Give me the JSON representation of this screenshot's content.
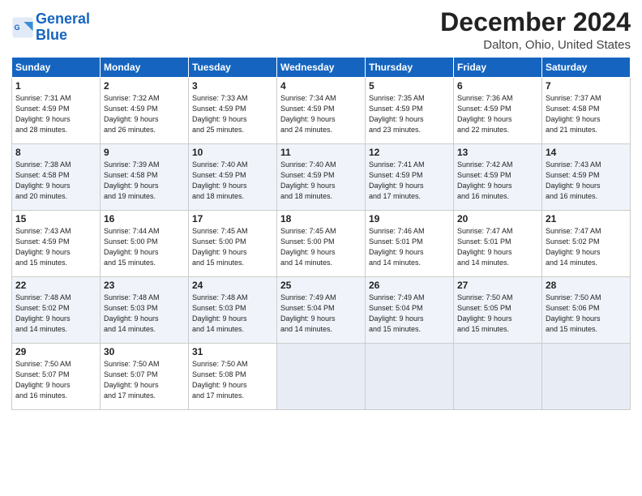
{
  "logo": {
    "line1": "General",
    "line2": "Blue"
  },
  "header": {
    "month": "December 2024",
    "location": "Dalton, Ohio, United States"
  },
  "days_of_week": [
    "Sunday",
    "Monday",
    "Tuesday",
    "Wednesday",
    "Thursday",
    "Friday",
    "Saturday"
  ],
  "weeks": [
    [
      {
        "day": "1",
        "info": "Sunrise: 7:31 AM\nSunset: 4:59 PM\nDaylight: 9 hours\nand 28 minutes."
      },
      {
        "day": "2",
        "info": "Sunrise: 7:32 AM\nSunset: 4:59 PM\nDaylight: 9 hours\nand 26 minutes."
      },
      {
        "day": "3",
        "info": "Sunrise: 7:33 AM\nSunset: 4:59 PM\nDaylight: 9 hours\nand 25 minutes."
      },
      {
        "day": "4",
        "info": "Sunrise: 7:34 AM\nSunset: 4:59 PM\nDaylight: 9 hours\nand 24 minutes."
      },
      {
        "day": "5",
        "info": "Sunrise: 7:35 AM\nSunset: 4:59 PM\nDaylight: 9 hours\nand 23 minutes."
      },
      {
        "day": "6",
        "info": "Sunrise: 7:36 AM\nSunset: 4:59 PM\nDaylight: 9 hours\nand 22 minutes."
      },
      {
        "day": "7",
        "info": "Sunrise: 7:37 AM\nSunset: 4:58 PM\nDaylight: 9 hours\nand 21 minutes."
      }
    ],
    [
      {
        "day": "8",
        "info": "Sunrise: 7:38 AM\nSunset: 4:58 PM\nDaylight: 9 hours\nand 20 minutes."
      },
      {
        "day": "9",
        "info": "Sunrise: 7:39 AM\nSunset: 4:58 PM\nDaylight: 9 hours\nand 19 minutes."
      },
      {
        "day": "10",
        "info": "Sunrise: 7:40 AM\nSunset: 4:59 PM\nDaylight: 9 hours\nand 18 minutes."
      },
      {
        "day": "11",
        "info": "Sunrise: 7:40 AM\nSunset: 4:59 PM\nDaylight: 9 hours\nand 18 minutes."
      },
      {
        "day": "12",
        "info": "Sunrise: 7:41 AM\nSunset: 4:59 PM\nDaylight: 9 hours\nand 17 minutes."
      },
      {
        "day": "13",
        "info": "Sunrise: 7:42 AM\nSunset: 4:59 PM\nDaylight: 9 hours\nand 16 minutes."
      },
      {
        "day": "14",
        "info": "Sunrise: 7:43 AM\nSunset: 4:59 PM\nDaylight: 9 hours\nand 16 minutes."
      }
    ],
    [
      {
        "day": "15",
        "info": "Sunrise: 7:43 AM\nSunset: 4:59 PM\nDaylight: 9 hours\nand 15 minutes."
      },
      {
        "day": "16",
        "info": "Sunrise: 7:44 AM\nSunset: 5:00 PM\nDaylight: 9 hours\nand 15 minutes."
      },
      {
        "day": "17",
        "info": "Sunrise: 7:45 AM\nSunset: 5:00 PM\nDaylight: 9 hours\nand 15 minutes."
      },
      {
        "day": "18",
        "info": "Sunrise: 7:45 AM\nSunset: 5:00 PM\nDaylight: 9 hours\nand 14 minutes."
      },
      {
        "day": "19",
        "info": "Sunrise: 7:46 AM\nSunset: 5:01 PM\nDaylight: 9 hours\nand 14 minutes."
      },
      {
        "day": "20",
        "info": "Sunrise: 7:47 AM\nSunset: 5:01 PM\nDaylight: 9 hours\nand 14 minutes."
      },
      {
        "day": "21",
        "info": "Sunrise: 7:47 AM\nSunset: 5:02 PM\nDaylight: 9 hours\nand 14 minutes."
      }
    ],
    [
      {
        "day": "22",
        "info": "Sunrise: 7:48 AM\nSunset: 5:02 PM\nDaylight: 9 hours\nand 14 minutes."
      },
      {
        "day": "23",
        "info": "Sunrise: 7:48 AM\nSunset: 5:03 PM\nDaylight: 9 hours\nand 14 minutes."
      },
      {
        "day": "24",
        "info": "Sunrise: 7:48 AM\nSunset: 5:03 PM\nDaylight: 9 hours\nand 14 minutes."
      },
      {
        "day": "25",
        "info": "Sunrise: 7:49 AM\nSunset: 5:04 PM\nDaylight: 9 hours\nand 14 minutes."
      },
      {
        "day": "26",
        "info": "Sunrise: 7:49 AM\nSunset: 5:04 PM\nDaylight: 9 hours\nand 15 minutes."
      },
      {
        "day": "27",
        "info": "Sunrise: 7:50 AM\nSunset: 5:05 PM\nDaylight: 9 hours\nand 15 minutes."
      },
      {
        "day": "28",
        "info": "Sunrise: 7:50 AM\nSunset: 5:06 PM\nDaylight: 9 hours\nand 15 minutes."
      }
    ],
    [
      {
        "day": "29",
        "info": "Sunrise: 7:50 AM\nSunset: 5:07 PM\nDaylight: 9 hours\nand 16 minutes."
      },
      {
        "day": "30",
        "info": "Sunrise: 7:50 AM\nSunset: 5:07 PM\nDaylight: 9 hours\nand 17 minutes."
      },
      {
        "day": "31",
        "info": "Sunrise: 7:50 AM\nSunset: 5:08 PM\nDaylight: 9 hours\nand 17 minutes."
      },
      null,
      null,
      null,
      null
    ]
  ]
}
